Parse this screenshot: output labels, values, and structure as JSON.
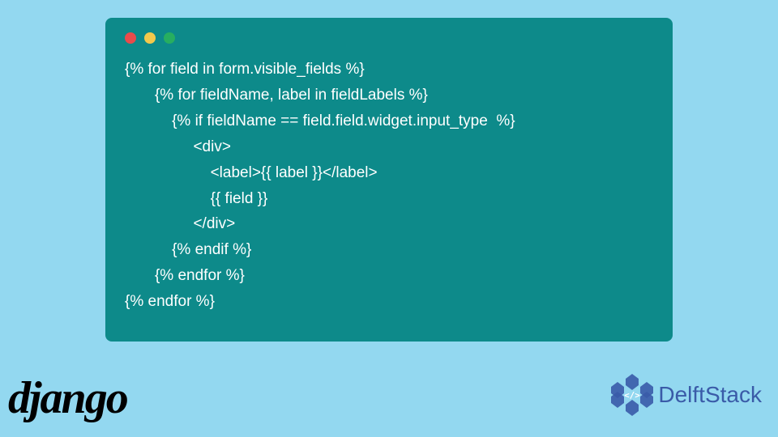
{
  "code": {
    "lines": [
      "{% for field in form.visible_fields %}",
      "       {% for fieldName, label in fieldLabels %}",
      "           {% if fieldName == field.field.widget.input_type  %}",
      "                <div>",
      "                    <label>{{ label }}</label>",
      "                    {{ field }}",
      "                </div>",
      "           {% endif %}",
      "       {% endfor %}",
      "{% endfor %}"
    ]
  },
  "logos": {
    "django": "django",
    "delftstack": "DelftStack"
  },
  "colors": {
    "background": "#93d8f0",
    "codeBlock": "#0d8a8a",
    "codeText": "#ffffff",
    "djangoText": "#000000",
    "delftstackText": "#3a5ba8"
  }
}
